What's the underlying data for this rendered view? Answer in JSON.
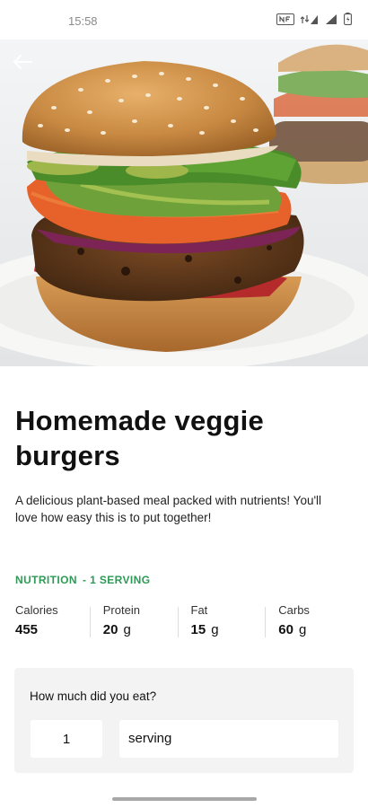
{
  "status_bar": {
    "time": "15:58",
    "icons": [
      "nfc-icon",
      "mobile-data-icon",
      "signal-icon",
      "battery-icon"
    ]
  },
  "header": {
    "back_icon": "back-arrow-icon"
  },
  "recipe": {
    "title": "Homemade veggie burgers",
    "description": "A delicious plant-based meal packed with nutrients! You'll love how easy this is to put together!"
  },
  "nutrition": {
    "heading": "NUTRITION",
    "serving_label": "- 1 SERVING",
    "accent_color": "#2e9a56",
    "items": [
      {
        "label": "Calories",
        "value": "455",
        "unit": ""
      },
      {
        "label": "Protein",
        "value": "20",
        "unit": "g"
      },
      {
        "label": "Fat",
        "value": "15",
        "unit": "g"
      },
      {
        "label": "Carbs",
        "value": "60",
        "unit": "g"
      }
    ]
  },
  "amount": {
    "question": "How much did you eat?",
    "quantity": "1",
    "unit": "serving"
  }
}
